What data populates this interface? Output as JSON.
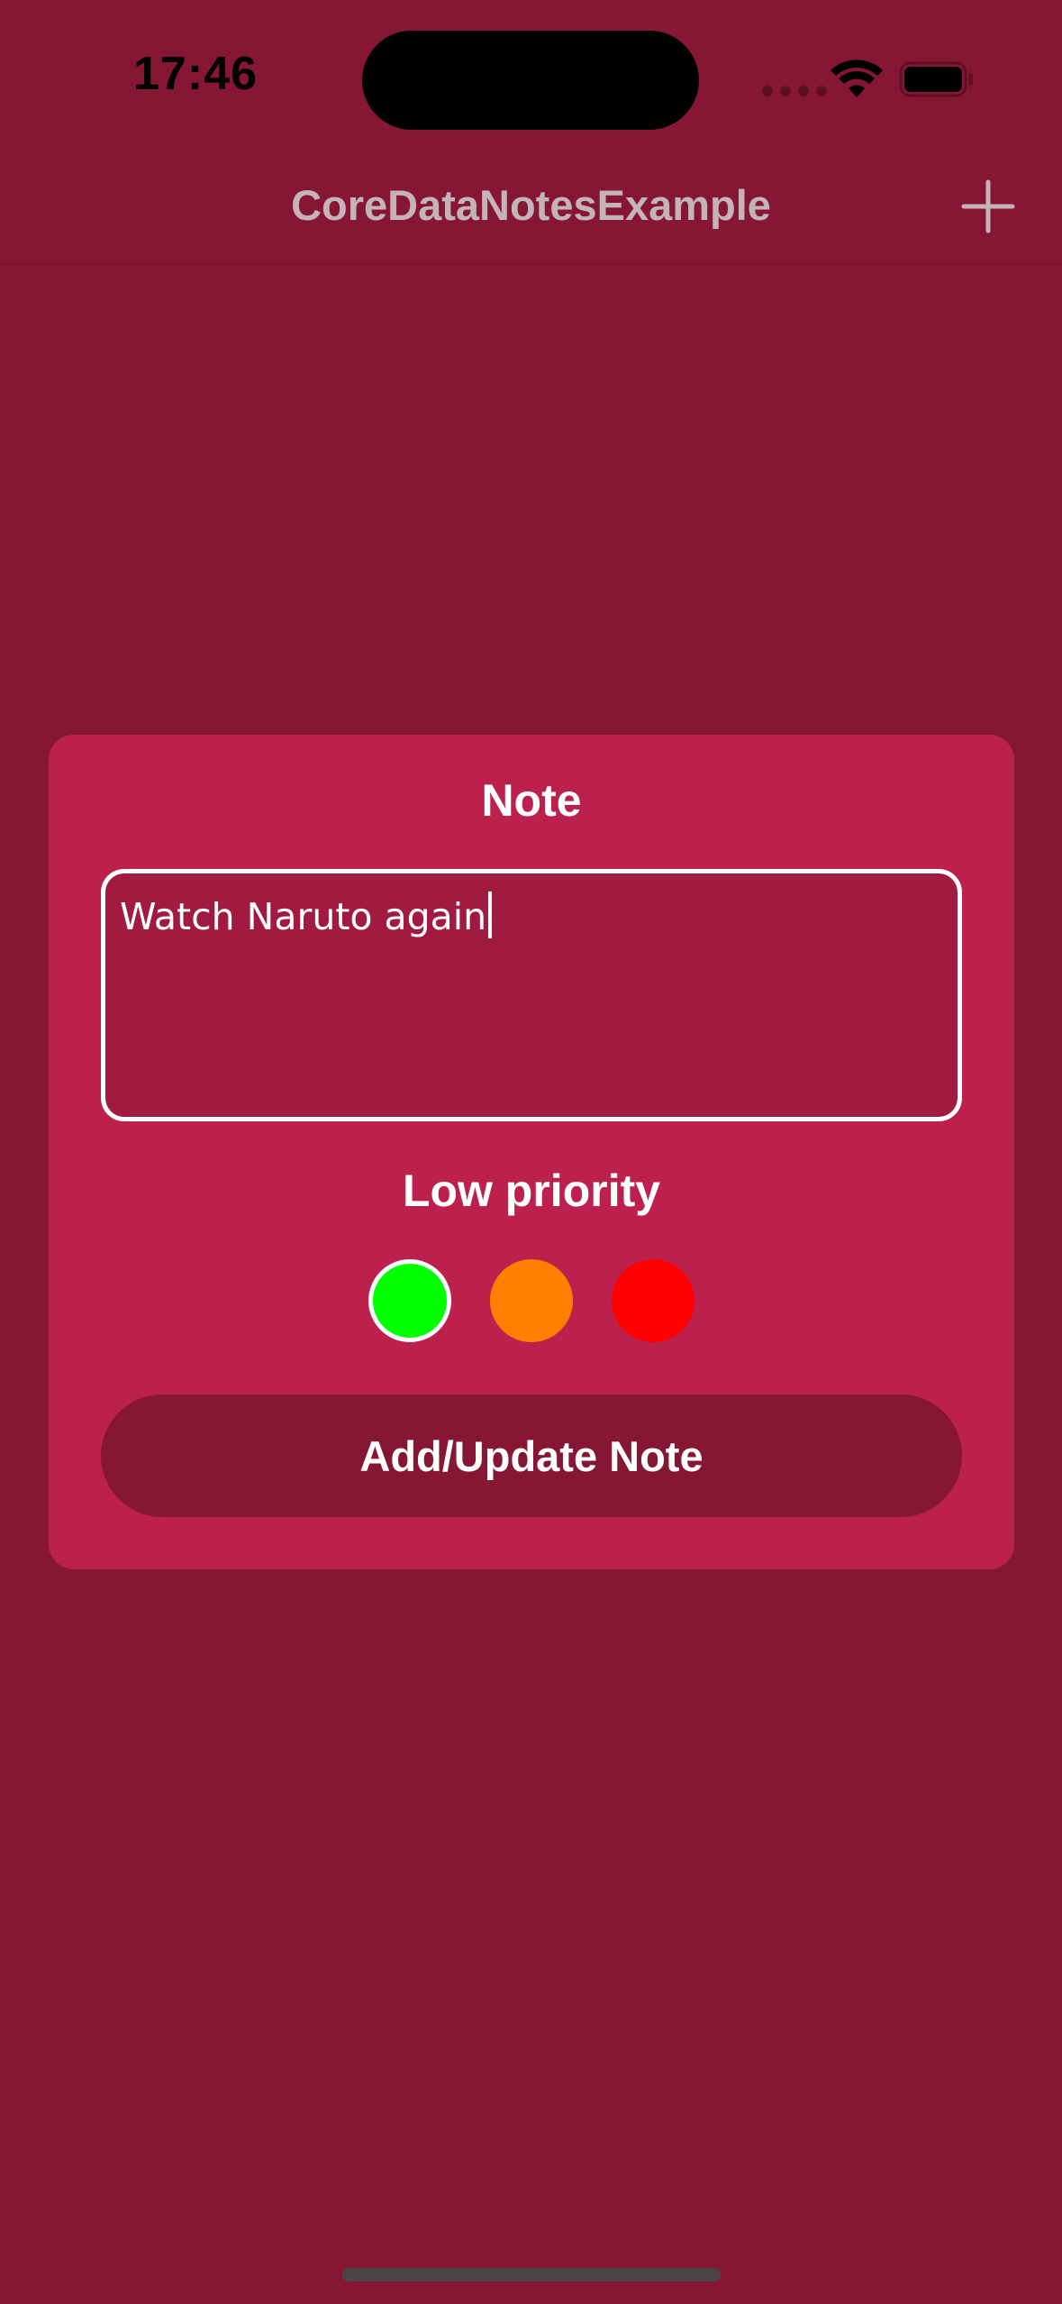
{
  "status_bar": {
    "time": "17:46",
    "icons": [
      "cellular-dots-icon",
      "wifi-icon",
      "battery-icon"
    ]
  },
  "nav_bar": {
    "title": "CoreDataNotesExample",
    "add_icon": "plus-icon"
  },
  "note_card": {
    "title": "Note",
    "text_value": "Watch Naruto again",
    "priority_label": "Low priority",
    "priority_options": [
      {
        "name": "low",
        "color": "#00ff00",
        "selected": true
      },
      {
        "name": "medium",
        "color": "#ff8000",
        "selected": false
      },
      {
        "name": "high",
        "color": "#ff0000",
        "selected": false
      }
    ],
    "submit_label": "Add/Update Note"
  },
  "colors": {
    "background": "#861734",
    "card": "#bc214d",
    "input_fill": "#a11b41",
    "button": "#861734",
    "text": "#ffffff"
  }
}
